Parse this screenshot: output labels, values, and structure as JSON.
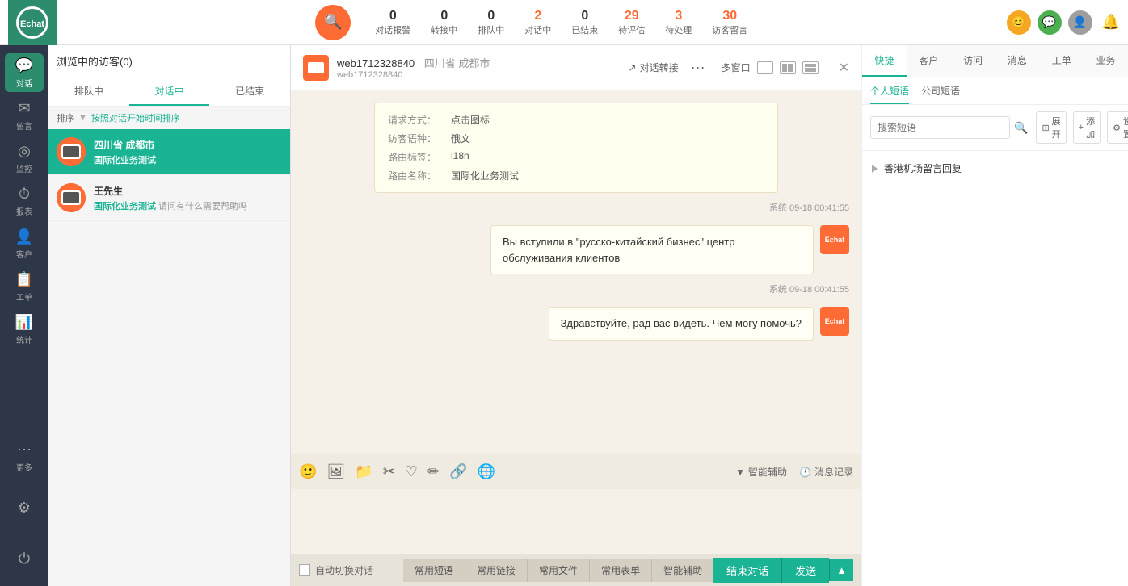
{
  "header": {
    "logo_text": "Echat",
    "search_icon": "🔍",
    "stats": [
      {
        "num": "0",
        "label": "对话报警",
        "active": false
      },
      {
        "num": "0",
        "label": "转接中",
        "active": false
      },
      {
        "num": "0",
        "label": "排队中",
        "active": false
      },
      {
        "num": "2",
        "label": "对话中",
        "active": true
      },
      {
        "num": "0",
        "label": "已结束",
        "active": false
      },
      {
        "num": "29",
        "label": "待评估",
        "active": true
      },
      {
        "num": "3",
        "label": "待处理",
        "active": true
      },
      {
        "num": "30",
        "label": "访客留言",
        "active": true
      }
    ]
  },
  "sidebar": {
    "items": [
      {
        "icon": "☰",
        "label": "对话",
        "active": true
      },
      {
        "icon": "✉",
        "label": "留言",
        "active": false
      },
      {
        "icon": "◎",
        "label": "监控",
        "active": false
      },
      {
        "icon": "⏱",
        "label": "报表",
        "active": false
      },
      {
        "icon": "👤",
        "label": "客户",
        "active": false
      },
      {
        "icon": "📋",
        "label": "工单",
        "active": false
      },
      {
        "icon": "📊",
        "label": "统计",
        "active": false
      },
      {
        "icon": "⋯",
        "label": "更多",
        "active": false
      }
    ],
    "bottom_items": [
      {
        "icon": "⚙",
        "label": "设置"
      },
      {
        "icon": "⏻",
        "label": "退出"
      }
    ]
  },
  "conv_panel": {
    "header": "浏览中的访客(0)",
    "tabs": [
      {
        "label": "排队中",
        "active": false
      },
      {
        "label": "对话中",
        "active": true
      },
      {
        "label": "已结束",
        "active": false
      }
    ],
    "sort_label": "排序",
    "sort_sub": "按照对话开始时间排序",
    "items": [
      {
        "name": "四川省 成都市",
        "sub_tag": "国际化业务测试",
        "sub_text": "",
        "active": true
      },
      {
        "name": "王先生",
        "sub_tag": "国际化业务测试",
        "sub_text": " 请问有什么需要帮助吗",
        "active": false
      }
    ]
  },
  "chat": {
    "user_id": "web1712328840",
    "location": "四川省 成都市",
    "sub_id": "web1712328840",
    "transfer_btn": "对话转接",
    "multi_window": "多窗口",
    "info_card": {
      "rows": [
        {
          "label": "请求方式：",
          "value": "点击图标"
        },
        {
          "label": "访客语种：",
          "value": "俄文"
        },
        {
          "label": "路由标签：",
          "value": "i18n"
        },
        {
          "label": "路由名称：",
          "value": "国际化业务测试"
        }
      ]
    },
    "messages": [
      {
        "type": "system",
        "time": "系统 09-18 00:41:55",
        "text": "Вы вступили в \"русско-китайский бизнес\" центр обслуживания клиентов"
      },
      {
        "type": "system",
        "time": "系统 09-18 00:41:55",
        "text": "Здравствуйте, рад вас видеть. Чем могу помочь?"
      }
    ],
    "toolbar": {
      "emoji": "😊",
      "image": "🖼",
      "folder": "📁",
      "scissors": "✂",
      "heart": "♡",
      "edit": "✎",
      "link": "🔗",
      "globe": "🌐",
      "smart_assist": "智能辅助",
      "msg_history": "消息记录"
    },
    "bottom": {
      "auto_switch": "自动切换对话",
      "end_btn": "结束对话",
      "send_btn": "发送",
      "quick_tabs": [
        "常用短语",
        "常用链接",
        "常用文件",
        "常用表单",
        "智能辅助"
      ]
    }
  },
  "right_panel": {
    "tabs": [
      "快捷",
      "客户",
      "访问",
      "消息",
      "工单",
      "业务"
    ],
    "active_tab": "快捷",
    "subtabs": [
      "个人短语",
      "公司短语"
    ],
    "active_subtab": "个人短语",
    "search_placeholder": "搜索短语",
    "actions": {
      "expand": "展开",
      "add": "添加",
      "settings": "设置"
    },
    "items": [
      {
        "label": "香港机场留言回复"
      }
    ]
  }
}
